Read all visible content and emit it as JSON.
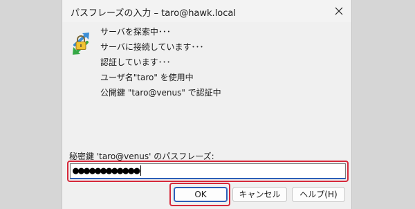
{
  "dialog": {
    "title": "パスフレーズの入力 – taro@hawk.local",
    "close_symbol": "✕"
  },
  "status_messages": [
    "サーバを探索中･･･",
    "サーバに接続しています･･･",
    "認証しています･･･",
    "ユーザ名\"taro\" を使用中",
    "公開鍵 \"taro@venus\" で認証中"
  ],
  "passphrase": {
    "label": "秘密鍵 'taro@venus' のパスフレーズ:",
    "masked_value": "●●●●●●●●●●●●"
  },
  "buttons": {
    "ok": "OK",
    "cancel": "キャンセル",
    "help": "ヘルプ(H)"
  },
  "icons": {
    "key": "key-exchange-icon",
    "close": "close-icon"
  },
  "colors": {
    "highlight": "#d6283a",
    "focus_accent": "#2c5fb8"
  }
}
